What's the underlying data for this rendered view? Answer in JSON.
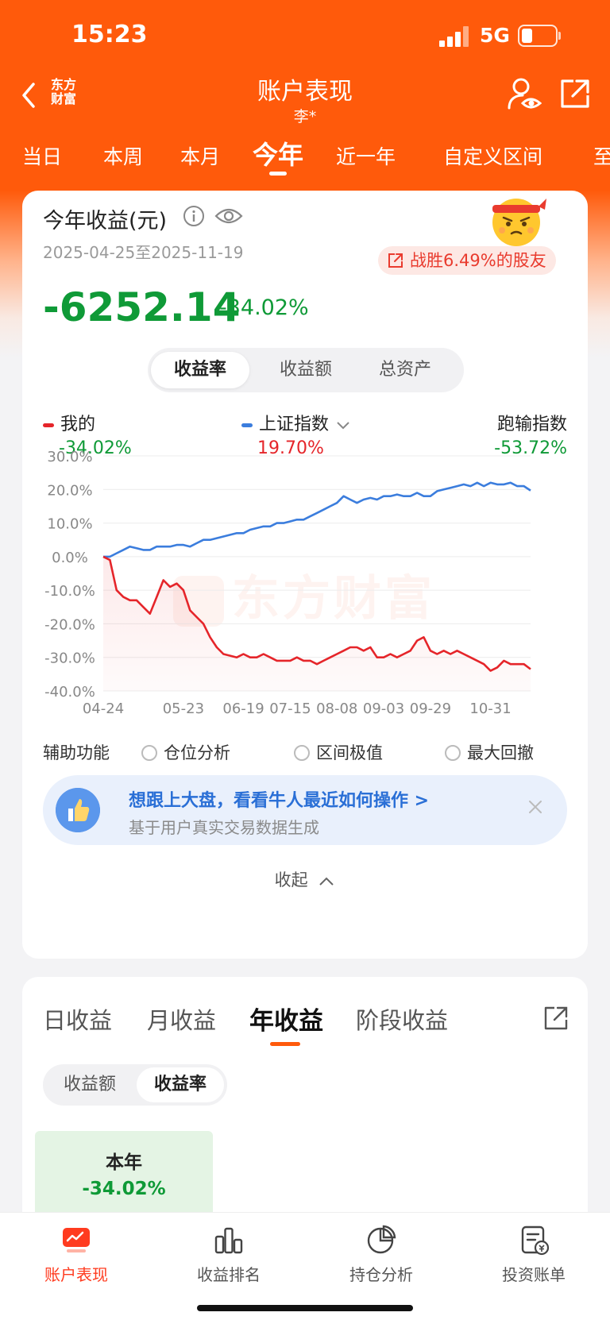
{
  "status": {
    "time": "15:23",
    "network": "5G",
    "battery_level": 0.25
  },
  "nav": {
    "brand": "东方\n财富",
    "title": "账户表现",
    "subtitle": "李*"
  },
  "period_tabs": [
    {
      "label": "当日",
      "active": false
    },
    {
      "label": "本周",
      "active": false
    },
    {
      "label": "本月",
      "active": false
    },
    {
      "label": "今年",
      "active": true
    },
    {
      "label": "近一年",
      "active": false
    },
    {
      "label": "自定义区间",
      "active": false
    },
    {
      "label": "至",
      "active": false
    }
  ],
  "summary": {
    "title": "今年收益(元)",
    "date_range": "2025-04-25至2025-11-19",
    "pk_badge": "战胜6.49%的股友",
    "value": "-6252.14",
    "pct": "-34.02%"
  },
  "metric_tabs": [
    {
      "label": "收益率",
      "active": true
    },
    {
      "label": "收益额",
      "active": false
    },
    {
      "label": "总资产",
      "active": false
    }
  ],
  "legend": [
    {
      "name": "我的",
      "value": "-34.02%",
      "color": "#e5252a",
      "value_color": "#0f9a37"
    },
    {
      "name": "上证指数",
      "value": "19.70%",
      "color": "#3b7ddd",
      "value_color": "#e5252a"
    },
    {
      "name": "跑输指数",
      "value": "-53.72%",
      "value_color": "#0f9a37"
    }
  ],
  "watermark": "东方财富",
  "chart_data": {
    "type": "line",
    "x": [
      "04-24",
      "04-28",
      "04-30",
      "05-02",
      "05-05",
      "05-07",
      "05-09",
      "05-12",
      "05-14",
      "05-16",
      "05-19",
      "05-21",
      "05-23",
      "05-26",
      "05-28",
      "05-30",
      "06-02",
      "06-05",
      "06-09",
      "06-12",
      "06-16",
      "06-19",
      "06-23",
      "06-26",
      "06-30",
      "07-03",
      "07-07",
      "07-10",
      "07-15",
      "07-18",
      "07-22",
      "07-25",
      "07-29",
      "08-01",
      "08-04",
      "08-08",
      "08-12",
      "08-15",
      "08-19",
      "08-22",
      "08-26",
      "08-29",
      "09-03",
      "09-06",
      "09-10",
      "09-13",
      "09-17",
      "09-20",
      "09-24",
      "09-29",
      "10-02",
      "10-06",
      "10-10",
      "10-14",
      "10-17",
      "10-21",
      "10-24",
      "10-28",
      "10-31",
      "11-04",
      "11-07",
      "11-11",
      "11-14",
      "11-17",
      "11-19"
    ],
    "x_ticks": [
      "04-24",
      "05-23",
      "06-19",
      "07-15",
      "08-08",
      "09-03",
      "09-29",
      "10-31"
    ],
    "series": [
      {
        "name": "我的",
        "color": "#e5252a",
        "values": [
          0,
          -1,
          -10,
          -12,
          -13,
          -13,
          -15,
          -17,
          -12,
          -7,
          -9,
          -8,
          -10,
          -16,
          -18,
          -20,
          -24,
          -27,
          -29,
          -29.5,
          -30,
          -29,
          -30,
          -30,
          -29,
          -30,
          -31,
          -31,
          -31,
          -30,
          -31,
          -31,
          -32,
          -31,
          -30,
          -29,
          -28,
          -27,
          -27,
          -28,
          -27,
          -30,
          -30,
          -29,
          -30,
          -29,
          -28,
          -25,
          -24,
          -28,
          -29,
          -28,
          -29,
          -28,
          -29,
          -30,
          -31,
          -32,
          -34,
          -33,
          -31,
          -32,
          -32,
          -32,
          -33.5
        ]
      },
      {
        "name": "上证指数",
        "color": "#3b7ddd",
        "values": [
          0,
          0,
          1,
          2,
          3,
          2.5,
          2,
          2,
          3,
          3,
          3,
          3.5,
          3.5,
          3,
          4,
          5,
          5,
          5.5,
          6,
          6.5,
          7,
          7,
          8,
          8.5,
          9,
          9,
          10,
          10,
          10.5,
          11,
          11,
          12,
          13,
          14,
          15,
          16,
          18,
          17,
          16,
          17,
          17.5,
          17,
          18,
          18,
          18.5,
          18,
          18,
          19,
          18,
          18,
          19.5,
          20,
          20.5,
          21,
          21.5,
          21,
          22,
          21,
          22,
          21.5,
          21.5,
          22,
          21,
          21,
          19.7
        ]
      }
    ],
    "ylim": [
      -40,
      30
    ],
    "y_ticks": [
      "30.0%",
      "20.0%",
      "10.0%",
      "0.0%",
      "-10.0%",
      "-20.0%",
      "-30.0%",
      "-40.0%"
    ],
    "grid": true
  },
  "aux": {
    "label": "辅助功能",
    "options": [
      "仓位分析",
      "区间极值",
      "最大回撤"
    ]
  },
  "promo": {
    "title": "想跟上大盘，看看牛人最近如何操作 >",
    "subtitle": "基于用户真实交易数据生成"
  },
  "collapse_label": "收起",
  "profit_tabs": [
    {
      "label": "日收益",
      "active": false
    },
    {
      "label": "月收益",
      "active": false
    },
    {
      "label": "年收益",
      "active": true
    },
    {
      "label": "阶段收益",
      "active": false
    }
  ],
  "profit_seg": [
    {
      "label": "收益额",
      "active": false
    },
    {
      "label": "收益率",
      "active": true
    }
  ],
  "year_cell": {
    "label": "本年",
    "value": "-34.02%"
  },
  "bottom_nav": [
    {
      "label": "账户表现",
      "icon": "account-performance-icon",
      "active": true
    },
    {
      "label": "收益排名",
      "icon": "ranking-bars-icon",
      "active": false
    },
    {
      "label": "持仓分析",
      "icon": "pie-chart-icon",
      "active": false
    },
    {
      "label": "投资账单",
      "icon": "bill-icon",
      "active": false
    }
  ]
}
